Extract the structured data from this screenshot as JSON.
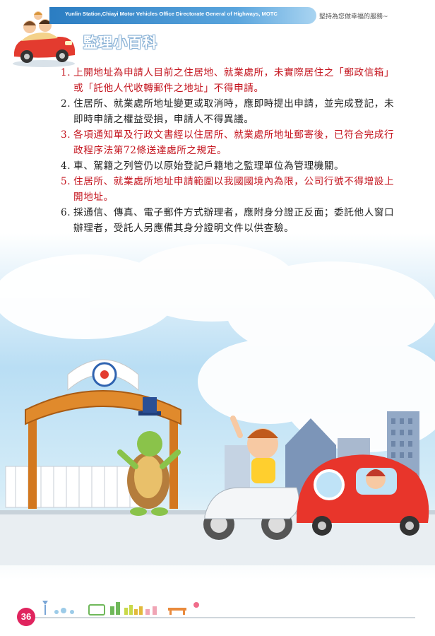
{
  "header": {
    "banner_text": "Yunlin Station,Chiayi Motor Vehicles Office Directorate General of Highways, MOTC",
    "slogan": "堅持為您做幸福的服務~",
    "section_title": "監理小百科"
  },
  "items": [
    {
      "num": "1.",
      "text": "上開地址為申請人目前之住居地、就業處所，未實際居住之「郵政信箱」或「託他人代收轉郵件之地址」不得申請。",
      "color": "#c4141e"
    },
    {
      "num": "2.",
      "text": "住居所、就業處所地址變更或取消時，應即時提出申請，並完成登記，未即時申請之權益受損，申請人不得異議。",
      "color": "#222222"
    },
    {
      "num": "3.",
      "text": "各項通知單及行政文書經以住居所、就業處所地址郵寄後，已符合完成行政程序法第72條送達處所之規定。",
      "color": "#c4141e"
    },
    {
      "num": "4.",
      "text": "車、駕籍之列管仍以原始登記戶籍地之監理單位為管理機關。",
      "color": "#222222"
    },
    {
      "num": "5.",
      "text": "住居所、就業處所地址申請範圍以我國國境內為限，公司行號不得增設上開地址。",
      "color": "#c4141e"
    },
    {
      "num": "6.",
      "text": "採通信、傳真、電子郵件方式辦理者，應附身分證正反面；委託他人窗口辦理者，受託人另應備其身分證明文件以供查驗。",
      "color": "#222222"
    }
  ],
  "footer": {
    "page_number": "36"
  }
}
